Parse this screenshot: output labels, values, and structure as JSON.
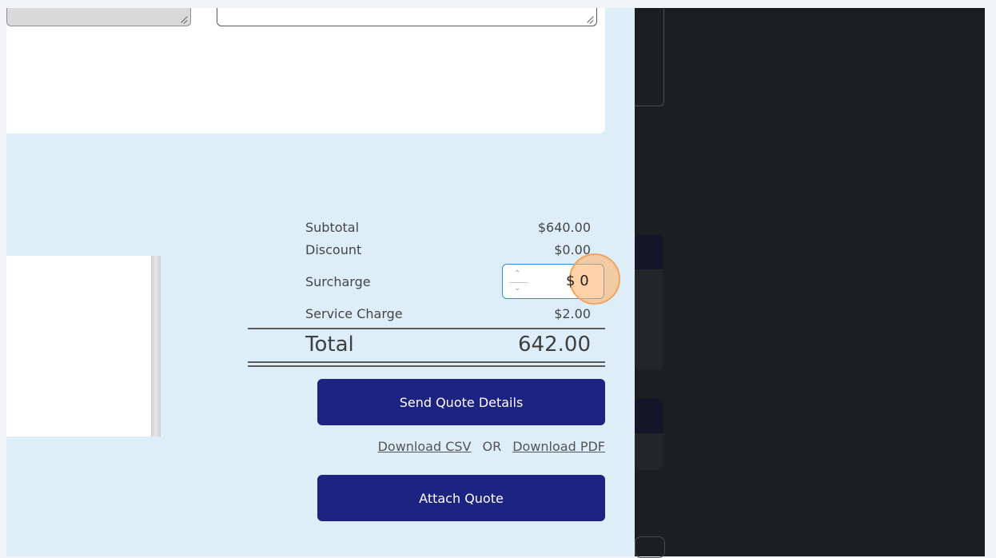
{
  "summary": {
    "subtotal": {
      "label": "Subtotal",
      "value": "$640.00"
    },
    "discount": {
      "label": "Discount",
      "value": "$0.00"
    },
    "surcharge": {
      "label": "Surcharge",
      "currency_symbol": "$",
      "value": "0"
    },
    "service_charge": {
      "label": "Service Charge",
      "value": "$2.00"
    },
    "total": {
      "label": "Total",
      "value": "642.00"
    }
  },
  "actions": {
    "send_quote_label": "Send Quote Details",
    "download_csv_label": "Download CSV",
    "or_label": "OR",
    "download_pdf_label": "Download PDF",
    "attach_quote_label": "Attach Quote"
  },
  "icons": {
    "spinner_up": "chevron-up-icon",
    "spinner_down": "chevron-down-icon"
  },
  "colors": {
    "panel_bg": "#deeef9",
    "button_bg": "#1d2381",
    "highlight": "#f7a25a",
    "input_border": "#2f8fe0"
  }
}
